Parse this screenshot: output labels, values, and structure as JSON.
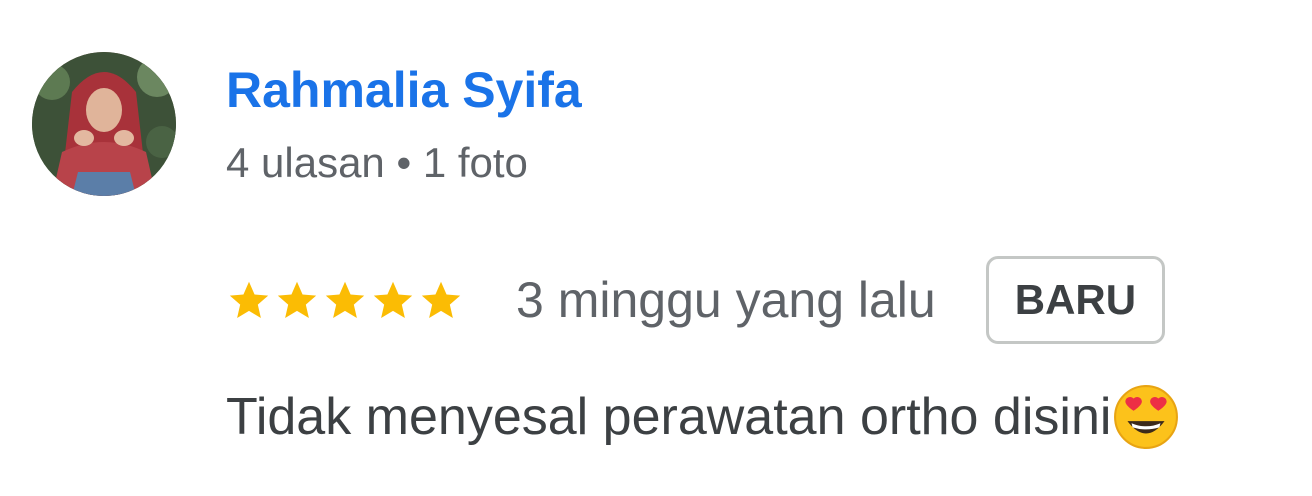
{
  "review": {
    "author_name": "Rahmalia Syifa",
    "author_meta": "4 ulasan • 1 foto",
    "rating": 5,
    "rating_max": 5,
    "time_ago": "3 minggu yang lalu",
    "badge": "BARU",
    "text": "Tidak menyesal perawatan ortho disini",
    "emoji_icon": "smiling-face-with-heart-eyes-icon"
  },
  "colors": {
    "name": "#1a73e8",
    "star": "#fbbc04",
    "secondary_text": "#5f6368",
    "body_text": "#3c4043",
    "badge_border": "#c4c7c5"
  }
}
